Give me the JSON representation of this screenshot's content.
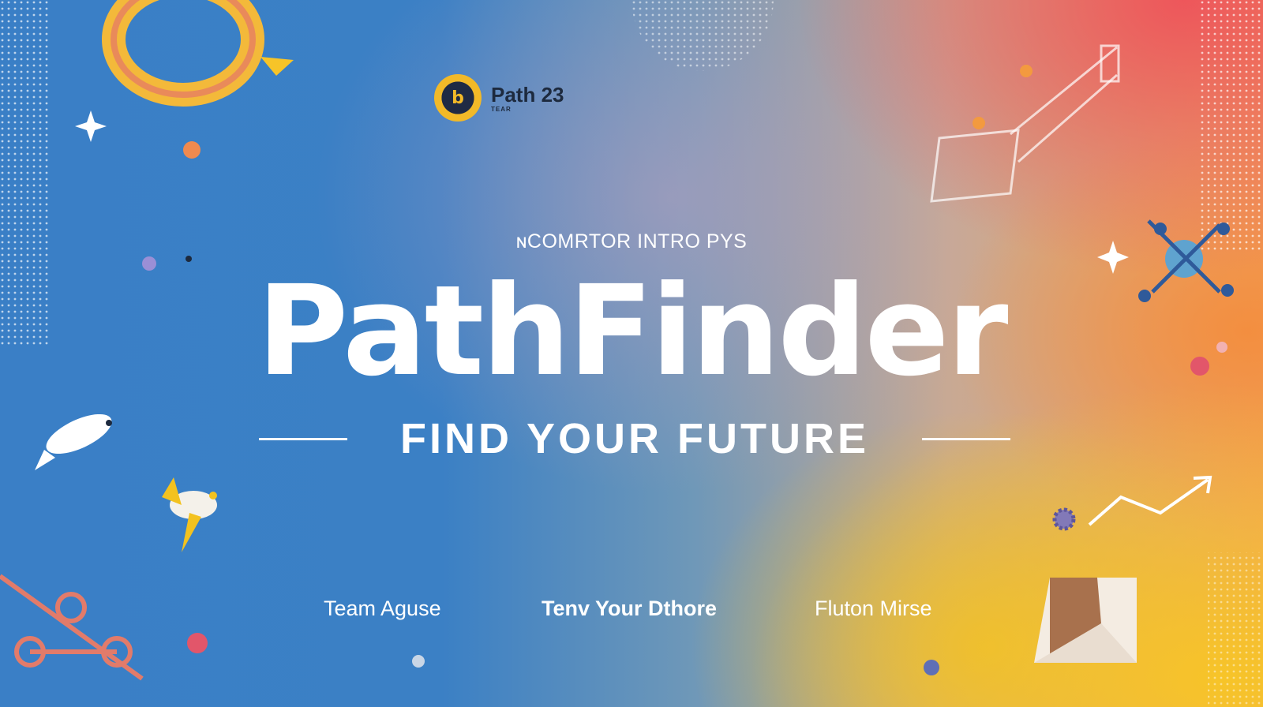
{
  "logo": {
    "mark": "b",
    "name": "Path 23",
    "sub": "TEAR"
  },
  "kicker": "ɴCOMRTOR INTRO PYS",
  "title": "PathFinder",
  "tagline": "FIND YOUR FUTURE",
  "names": [
    "Team Aguse",
    "Tenv Your Dthore",
    "Fluton Mirse"
  ],
  "colors": {
    "left_blue": "#3b80c5",
    "top_right_red": "#ee525a",
    "bottom_right_yellow": "#f7c428",
    "text": "#ffffff",
    "logo_text": "#1d2a3e"
  },
  "icons": [
    "fish-icon",
    "bird-icon",
    "drone-icon",
    "trend-arrow-icon",
    "gear-icon",
    "sparkle-icon",
    "ring-icon",
    "chain-icon",
    "cube-icon"
  ]
}
